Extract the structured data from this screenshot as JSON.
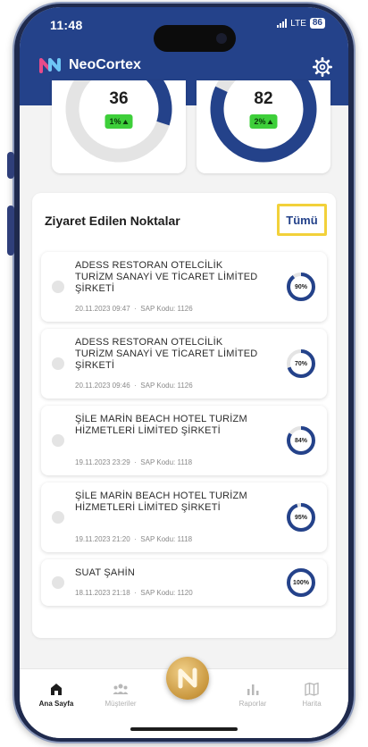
{
  "status_bar": {
    "time": "11:48",
    "network": "LTE",
    "battery": "86"
  },
  "header": {
    "app_name": "NeoCortex",
    "settings_icon": "gear-icon",
    "background_color": "#24428a"
  },
  "stats": [
    {
      "value": "36",
      "change": "1%",
      "progress": 0.3
    },
    {
      "value": "82",
      "change": "2%",
      "progress": 0.82
    }
  ],
  "visited": {
    "title": "Ziyaret Edilen Noktalar",
    "all_label": "Tümü",
    "meta_separator": "·",
    "items": [
      {
        "name": "ADESS RESTORAN OTELCİLİK TURİZM SANAYİ VE TİCARET LİMİTED ŞİRKETİ",
        "date": "20.11.2023 09:47",
        "sap": "SAP Kodu: 1126",
        "percent_label": "90%",
        "progress": 0.9
      },
      {
        "name": "ADESS RESTORAN OTELCİLİK TURİZM SANAYİ VE TİCARET LİMİTED ŞİRKETİ",
        "date": "20.11.2023 09:46",
        "sap": "SAP Kodu: 1126",
        "percent_label": "70%",
        "progress": 0.7
      },
      {
        "name": "ŞİLE MARİN BEACH HOTEL TURİZM HİZMETLERİ LİMİTED ŞİRKETİ",
        "date": "19.11.2023 23:29",
        "sap": "SAP Kodu: 1118",
        "percent_label": "84%",
        "progress": 0.84
      },
      {
        "name": "ŞİLE MARİN BEACH HOTEL TURİZM HİZMETLERİ LİMİTED ŞİRKETİ",
        "date": "19.11.2023 21:20",
        "sap": "SAP Kodu: 1118",
        "percent_label": "95%",
        "progress": 0.95
      },
      {
        "name": "SUAT ŞAHİN",
        "date": "18.11.2023 21:18",
        "sap": "SAP Kodu: 1120",
        "percent_label": "100%",
        "progress": 1.0
      }
    ]
  },
  "tabbar": {
    "tabs": [
      {
        "label": "Ana Sayfa",
        "icon": "home-icon",
        "active": true
      },
      {
        "label": "Müşteriler",
        "icon": "users-icon",
        "active": false
      },
      {
        "label": "Raporlar",
        "icon": "bar-chart-icon",
        "active": false
      },
      {
        "label": "Harita",
        "icon": "map-icon",
        "active": false
      }
    ],
    "center_icon": "neocortex-n-icon"
  },
  "colors": {
    "primary": "#24428a",
    "accent_yellow": "#f2d13a",
    "badge_green": "#3ecf3a",
    "ring_track": "#e4e4e4",
    "gold": "#c9973e"
  }
}
